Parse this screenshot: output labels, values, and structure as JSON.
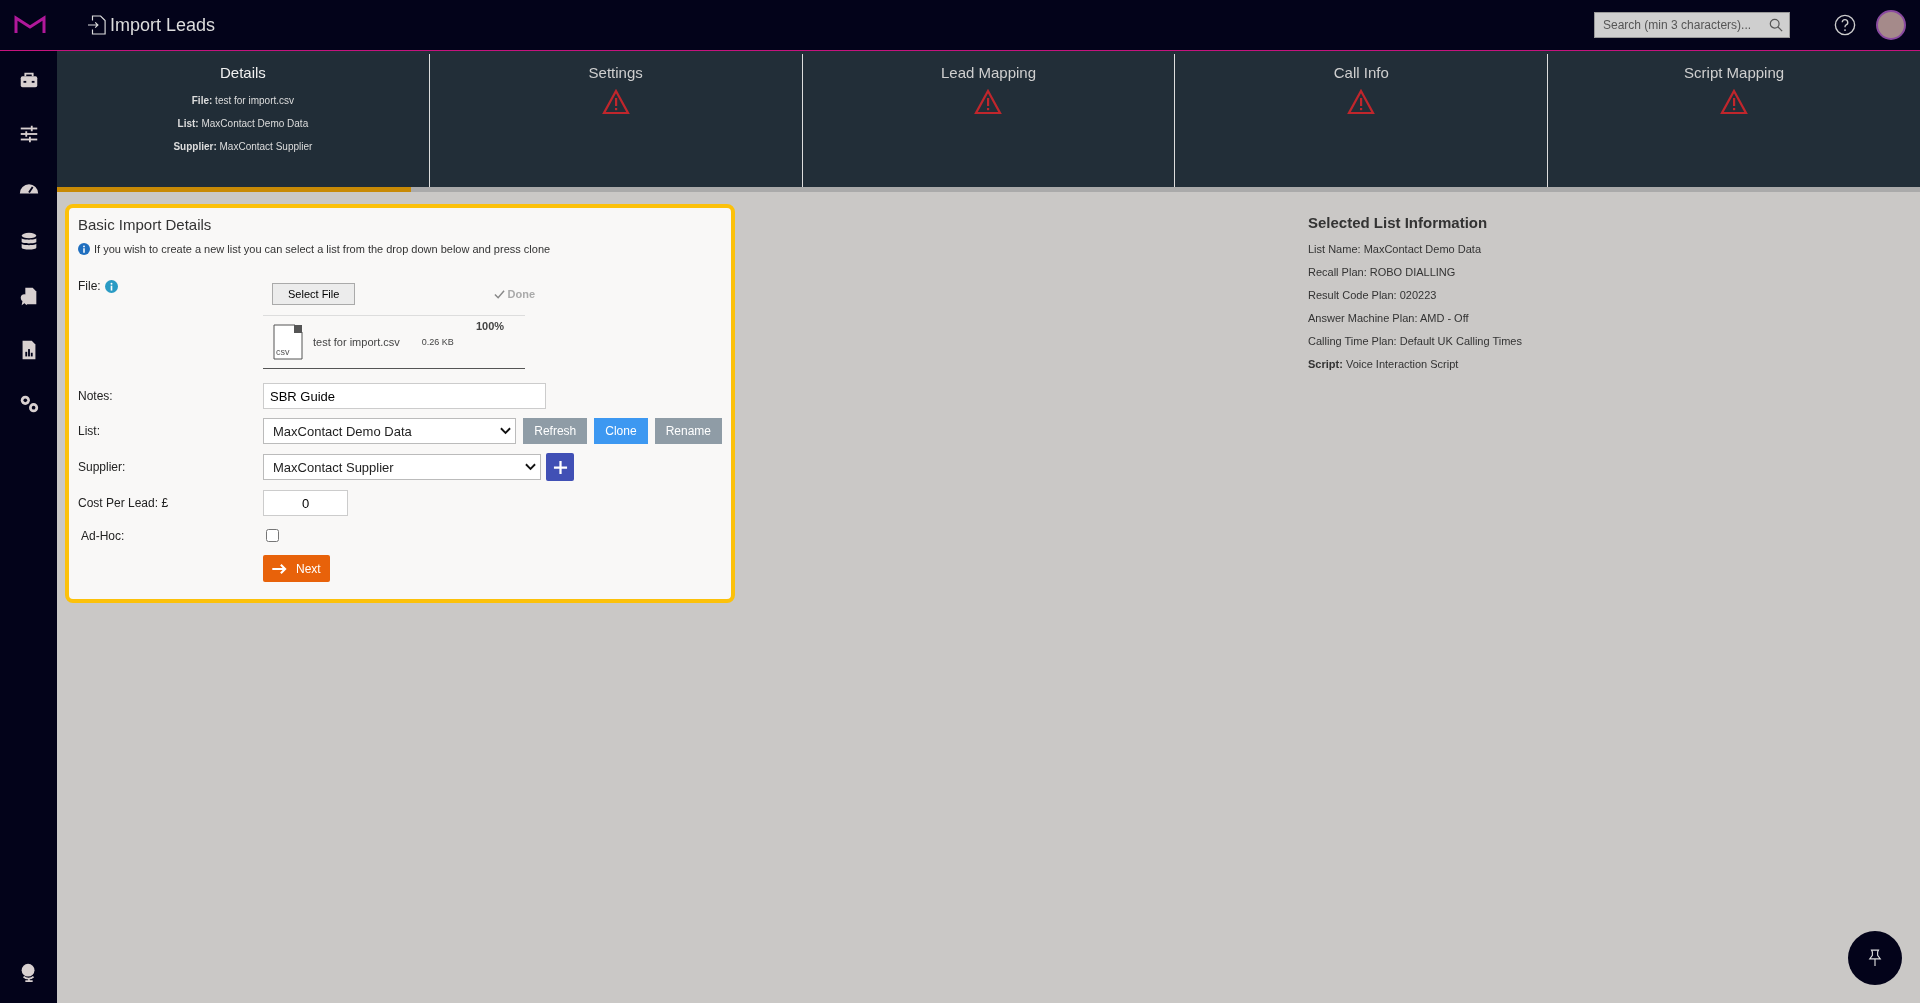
{
  "header": {
    "title": "Import Leads",
    "search": {
      "placeholder": "Search (min 3 characters)..."
    }
  },
  "steps": [
    {
      "label": "Details",
      "selected": true,
      "warning": false,
      "lines": [
        "**File:** test for import.csv",
        "**List:** MaxContact Demo Data",
        "**Supplier:** MaxContact Supplier"
      ]
    },
    {
      "label": "Settings",
      "selected": false,
      "warning": true
    },
    {
      "label": "Lead Mapping",
      "selected": false,
      "warning": true
    },
    {
      "label": "Call Info",
      "selected": false,
      "warning": true
    },
    {
      "label": "Script Mapping",
      "selected": false,
      "warning": true
    }
  ],
  "progress": {
    "level": 0.19
  },
  "form": {
    "title": "Basic Import Details",
    "info": "If you wish to create a new list you can select a list from the drop down below and press clone",
    "file_label": "File:",
    "select_file": "Select File",
    "done": "Done",
    "upload": {
      "type": "csv",
      "name": "test for import.csv",
      "size": "0.26 KB",
      "percent": "100%"
    },
    "notes_label": "Notes:",
    "notes": "SBR Guide",
    "list_label": "List:",
    "list": "MaxContact Demo Data",
    "list_buttons": [
      {
        "label": "Refresh",
        "kind": "secondary"
      },
      {
        "label": "Clone",
        "kind": "primary"
      },
      {
        "label": "Rename",
        "kind": "secondary"
      }
    ],
    "supplier_label": "Supplier:",
    "supplier": "MaxContact Supplier",
    "cost_label": "Cost Per Lead: £",
    "cost": "0",
    "adhoc_label": "Ad-Hoc:",
    "adhoc_checked": false,
    "next": "Next"
  },
  "list_info": {
    "title": "Selected List Information",
    "lines": [
      "List Name: MaxContact Demo Data",
      "Recall Plan: ROBO DIALLING",
      "Result Code Plan: 020223",
      "Answer Machine Plan: AMD - Off",
      "Calling Time Plan: Default UK Calling Times",
      "**Script:** Voice Interaction Script"
    ]
  }
}
